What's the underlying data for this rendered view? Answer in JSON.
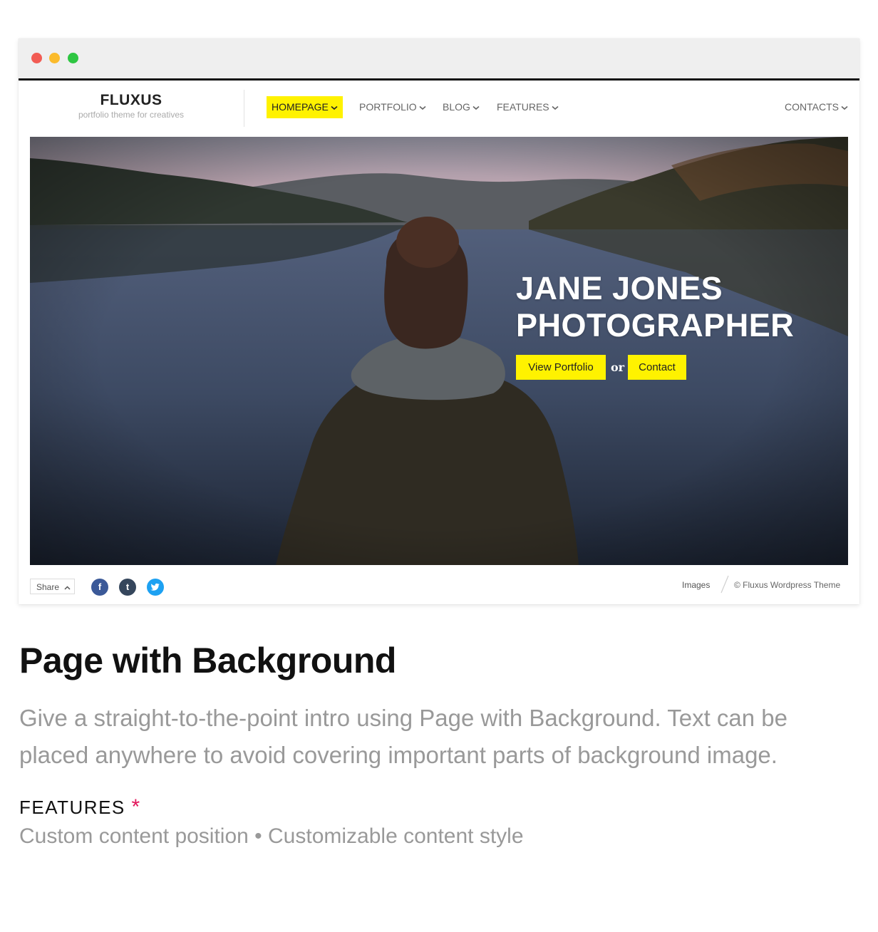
{
  "site": {
    "logo_name": "FLUXUS",
    "logo_tagline": "portfolio theme for creatives",
    "nav": [
      {
        "label": "HOMEPAGE",
        "active": true
      },
      {
        "label": "PORTFOLIO",
        "active": false
      },
      {
        "label": "BLOG",
        "active": false
      },
      {
        "label": "FEATURES",
        "active": false
      },
      {
        "label": "CONTACTS",
        "active": false
      }
    ],
    "accent_color": "#fff200"
  },
  "hero": {
    "title_line1": "JANE JONES",
    "title_line2": "PHOTOGRAPHER",
    "primary_button": "View Portfolio",
    "or_text": "or",
    "secondary_button": "Contact"
  },
  "footer": {
    "share_label": "Share",
    "social": [
      {
        "name": "facebook-icon",
        "glyph": "f"
      },
      {
        "name": "tumblr-icon",
        "glyph": "t"
      },
      {
        "name": "twitter-icon",
        "glyph": "🐦"
      }
    ],
    "images_link": "Images",
    "copyright": "© Fluxus Wordpress Theme"
  },
  "section": {
    "title": "Page with Background",
    "description": "Give a straight-to-the-point intro using Page with Background. Text can be placed anywhere to avoid covering important parts of background image.",
    "features_label": "FEATURES",
    "features_marker": "*",
    "features_list": "Custom content position • Customizable content style"
  }
}
